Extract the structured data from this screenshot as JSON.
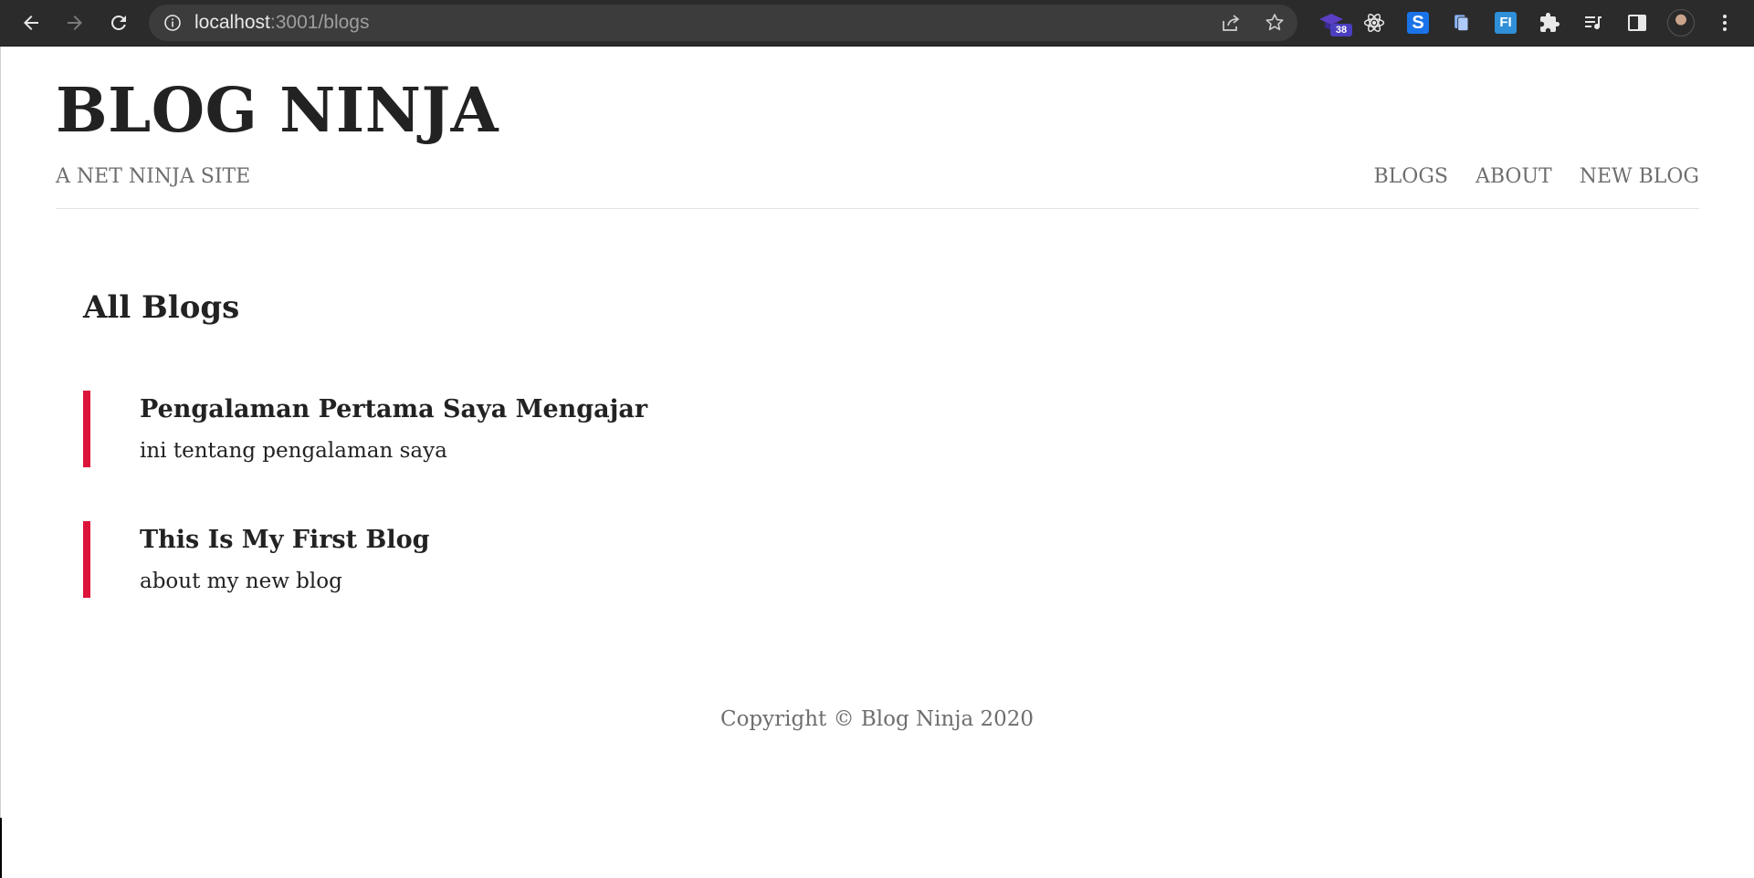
{
  "browser": {
    "url_host": "localhost",
    "url_path": ":3001/blogs",
    "extension_badge": "38",
    "s_extension_letter": "S",
    "fi_extension_letters": "FI"
  },
  "site": {
    "title": "BLOG NINJA",
    "tagline": "A NET NINJA SITE",
    "nav": [
      {
        "label": "BLOGS"
      },
      {
        "label": "ABOUT"
      },
      {
        "label": "NEW BLOG"
      }
    ]
  },
  "main": {
    "heading": "All Blogs",
    "blogs": [
      {
        "title": "Pengalaman Pertama Saya Mengajar",
        "snippet": "ini tentang pengalaman saya"
      },
      {
        "title": "This Is My First Blog",
        "snippet": "about my new blog"
      }
    ]
  },
  "footer": {
    "copyright": "Copyright © Blog Ninja 2020"
  },
  "colors": {
    "accent": "#dc143c",
    "muted_text": "#6e6e6e",
    "heading_text": "#222222",
    "chrome_bg": "#2b2b2b"
  },
  "icons": {
    "back": "arrow-left-icon",
    "forward": "arrow-right-icon",
    "reload": "reload-icon",
    "info": "info-icon",
    "share": "share-icon",
    "star": "star-icon",
    "react": "react-icon",
    "puzzle": "extensions-icon",
    "media": "media-queue-icon",
    "side_panel": "side-panel-icon",
    "menu": "kebab-menu-icon"
  }
}
